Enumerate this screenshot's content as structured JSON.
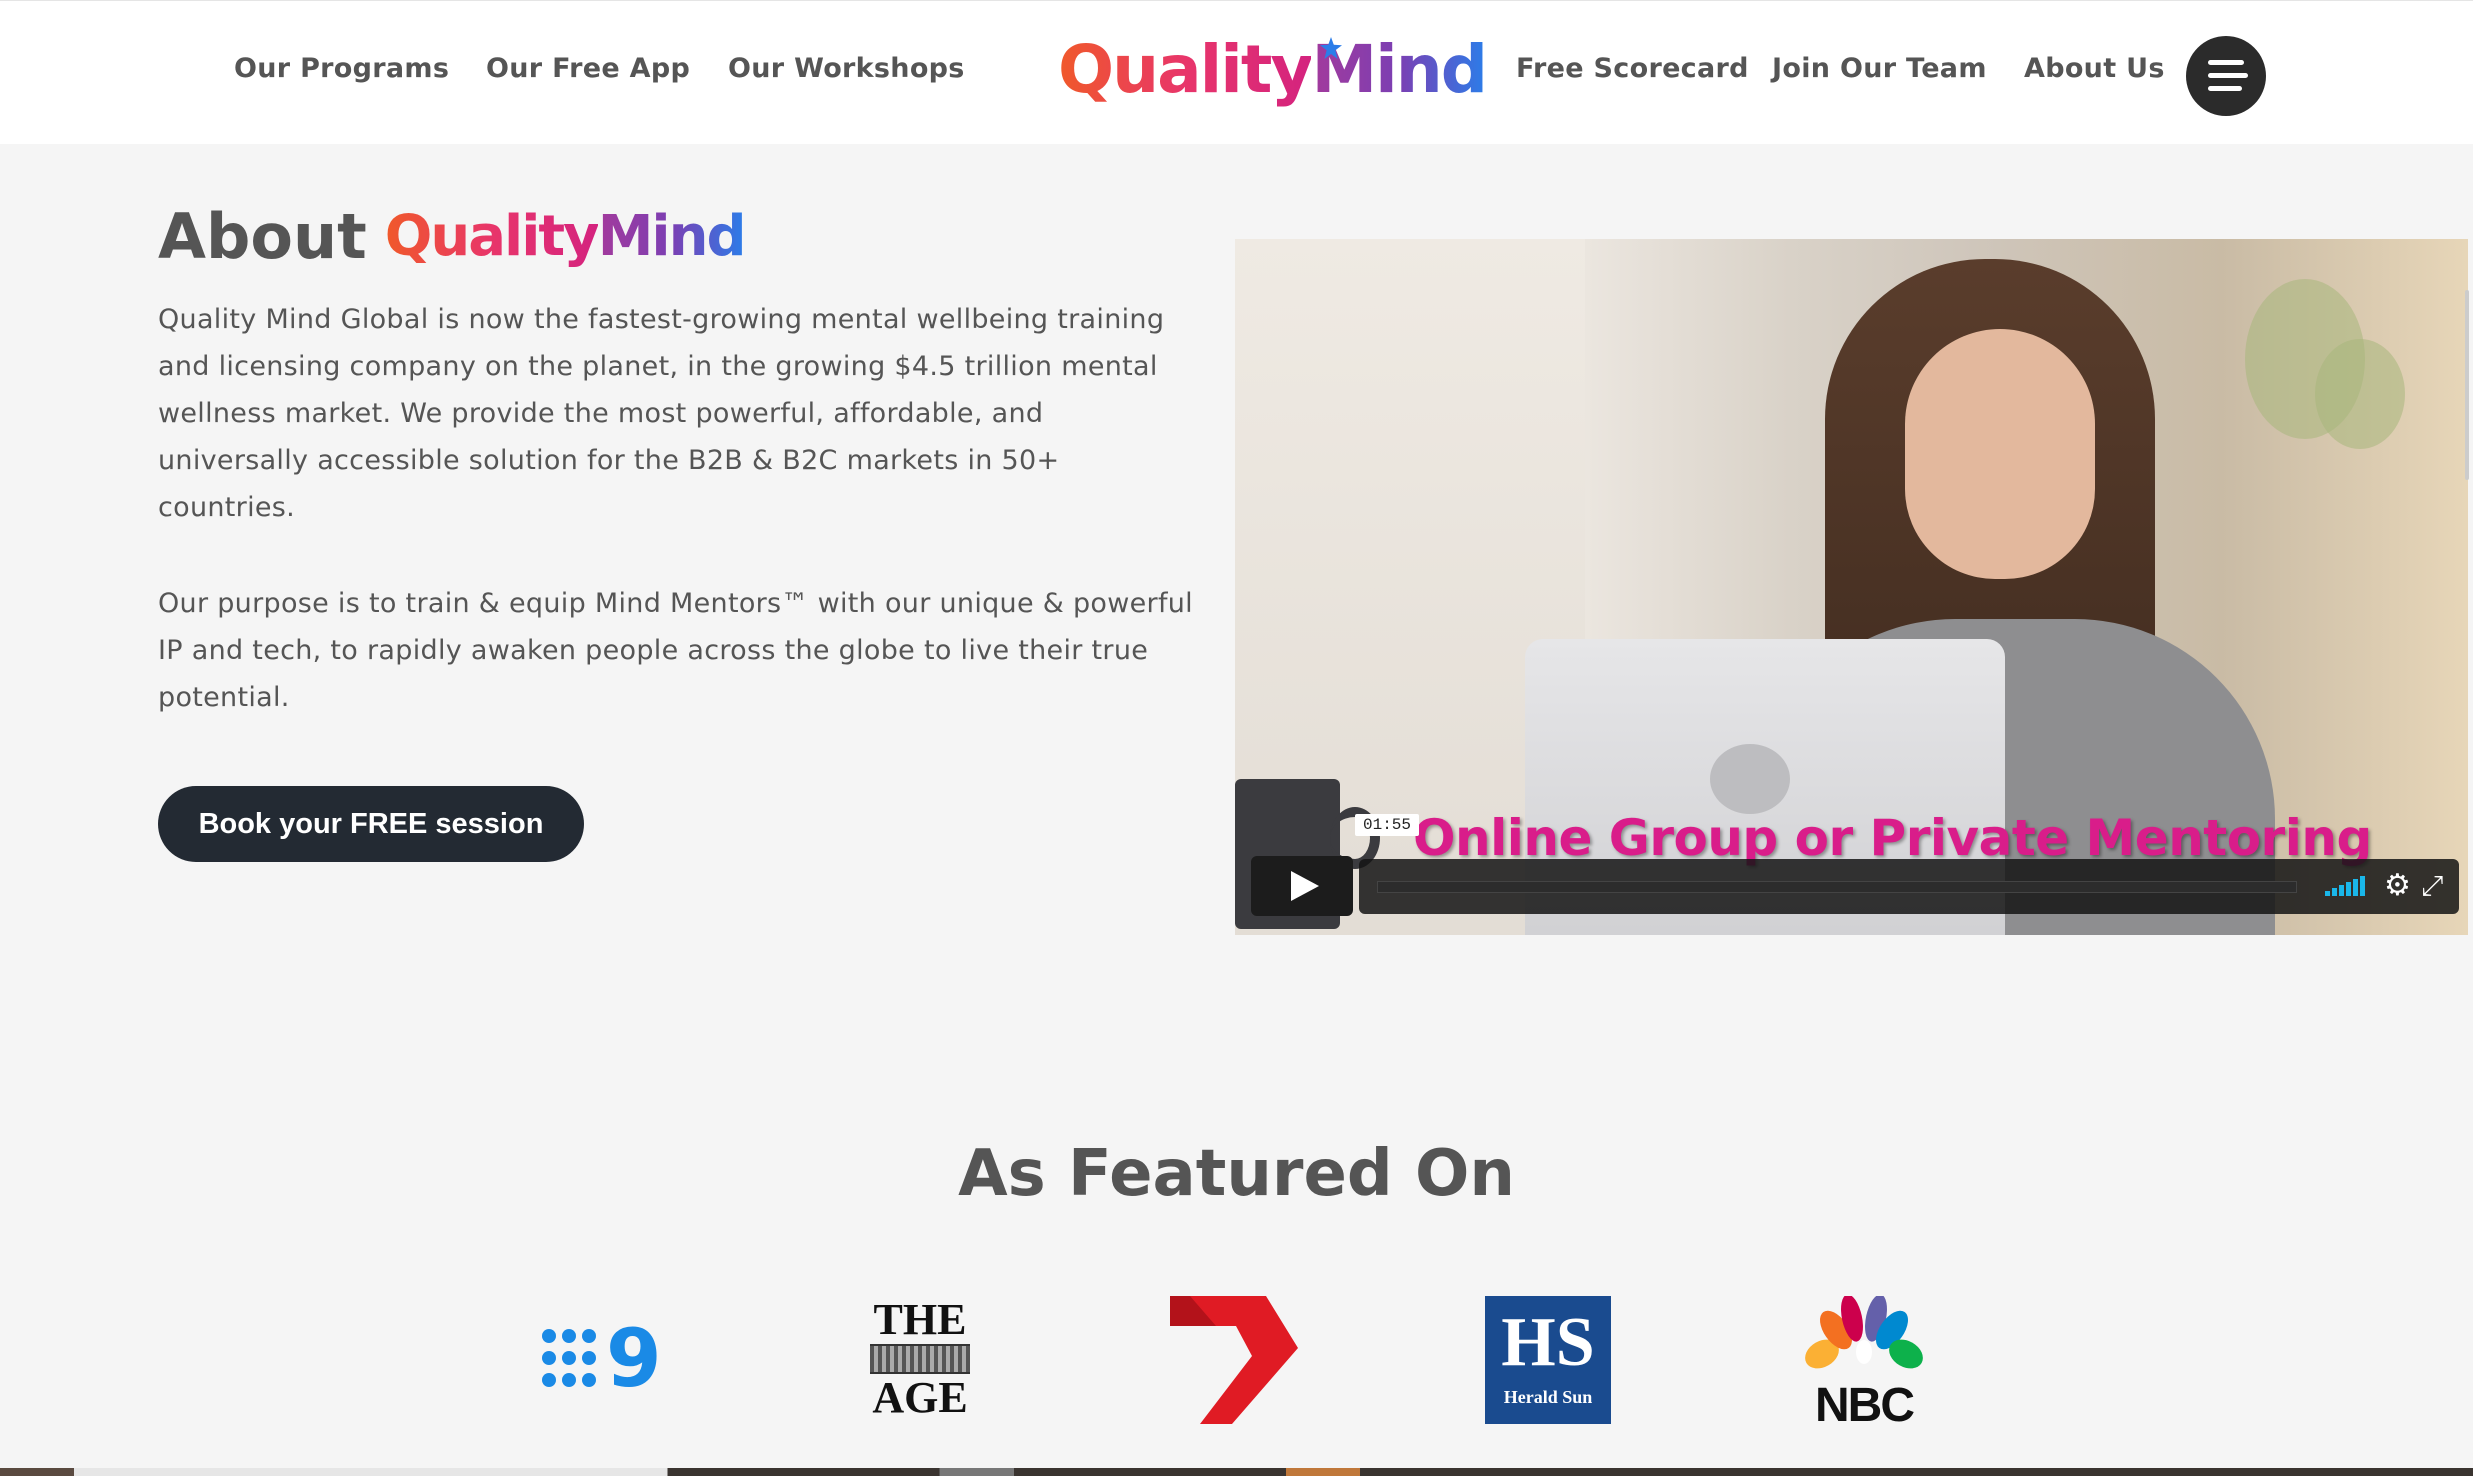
{
  "nav": {
    "left": [
      "Our Programs",
      "Our Free App",
      "Our Workshops"
    ],
    "right": [
      "Free Scorecard",
      "Join Our Team",
      "About Us"
    ],
    "logo": {
      "part1": "Quality",
      "part2": "Mind"
    }
  },
  "about": {
    "heading": "About",
    "logo_part1": "Quality",
    "logo_part2": "Mind",
    "para1": "Quality Mind Global is now the fastest-growing mental wellbeing training and licensing company on the planet, in the growing $4.5 trillion mental wellness market. We provide the most powerful, affordable, and universally accessible solution for the B2B & B2C markets in 50+ countries.",
    "para2": "Our purpose is to train & equip Mind Mentors™ with our unique & powerful IP and tech, to rapidly awaken people across the globe to live their true potential.",
    "cta": "Book your FREE session"
  },
  "video": {
    "caption": "Online Group or Private Mentoring",
    "time": "01:55",
    "icons": [
      "play-icon",
      "volume-icon",
      "settings-gear-icon",
      "fullscreen-icon"
    ]
  },
  "featured": {
    "title": "As Featured On",
    "logos": [
      {
        "name": "channel-nine",
        "text": "9"
      },
      {
        "name": "the-age",
        "top": "THE",
        "bottom": "AGE"
      },
      {
        "name": "channel-seven",
        "text": "7"
      },
      {
        "name": "herald-sun",
        "big": "HS",
        "small": "Herald Sun"
      },
      {
        "name": "nbc",
        "text": "NBC"
      }
    ]
  },
  "colors": {
    "cta_bg": "#232a33",
    "caption": "#d91d8a",
    "logo_orange": "#f0592a",
    "logo_pink": "#d4237f",
    "logo_purple": "#7b3fb3",
    "logo_blue": "#2b7de9",
    "seven_red": "#e01b24",
    "hs_blue": "#1a4b8f",
    "nine_blue": "#1a8ae6"
  }
}
